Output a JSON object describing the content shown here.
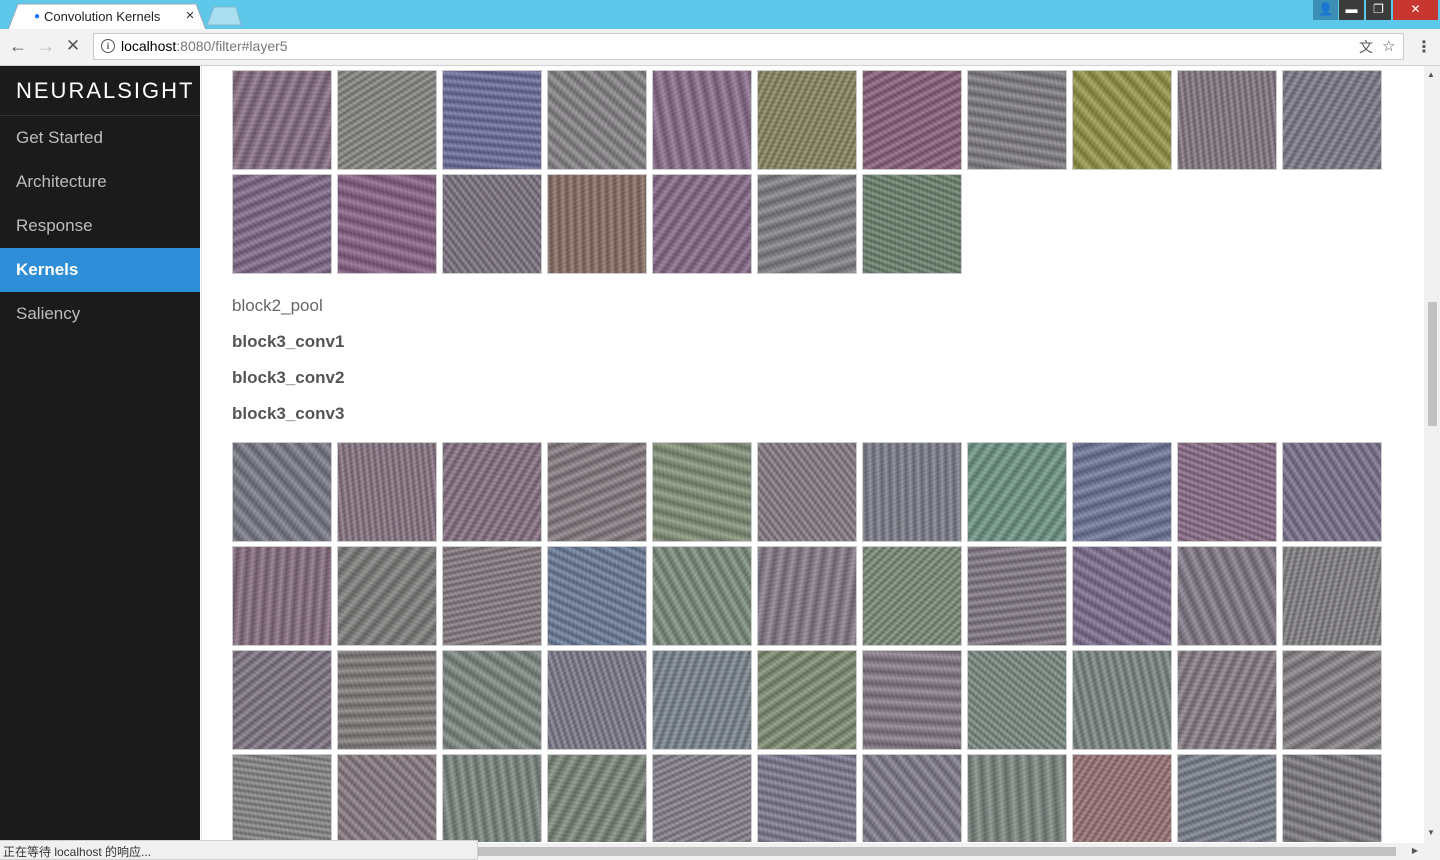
{
  "browser": {
    "tab_title": "Convolution Kernels",
    "tab_close": "×",
    "url_host": "localhost",
    "url_rest": ":8080/filter#layer5",
    "status_text": "正在等待 localhost 的响应...",
    "window_buttons": {
      "minimize": "▬",
      "restore": "❐",
      "close": "✕"
    },
    "icons": {
      "back": "back-arrow-icon",
      "forward": "forward-arrow-icon",
      "stop": "stop-icon",
      "info": "info-icon",
      "translate": "translate-icon",
      "star": "star-icon",
      "menu": "menu-icon"
    }
  },
  "sidebar": {
    "brand": "NEURALSIGHT",
    "items": [
      {
        "label": "Get Started",
        "active": false
      },
      {
        "label": "Architecture",
        "active": false
      },
      {
        "label": "Response",
        "active": false
      },
      {
        "label": "Kernels",
        "active": true
      },
      {
        "label": "Saliency",
        "active": false
      }
    ]
  },
  "main": {
    "layers": [
      {
        "label": "block2_pool"
      },
      {
        "label": "block3_conv1"
      },
      {
        "label": "block3_conv2"
      },
      {
        "label": "block3_conv3"
      }
    ],
    "kernel_group_1": [
      "#8a6f86",
      "#8a8a86",
      "#6f6fa4",
      "#8a878a",
      "#8e6e8f",
      "#8c8a5e",
      "#8e5f7d",
      "#838085",
      "#9a9a46",
      "#877a86",
      "#7f7d8d",
      "#836a8c",
      "#8b6088",
      "#7f7585",
      "#8c6f66",
      "#8a6b8c",
      "#858387",
      "#6e8570"
    ],
    "kernel_group_2": [
      "#7a7c8a",
      "#8b7685",
      "#8a7286",
      "#8a7e85",
      "#86957b",
      "#8b8089",
      "#7f818e",
      "#6f9a88",
      "#6f77a0",
      "#8f6d8d",
      "#7c7292",
      "#8a6f82",
      "#7f7f7d",
      "#8a7e86",
      "#6d7fa0",
      "#7f9180",
      "#887d8c",
      "#7e9078",
      "#847a86",
      "#7f6e92",
      "#857c8a",
      "#878488",
      "#817787",
      "#85807f",
      "#808b84",
      "#817c90",
      "#7d8893",
      "#829075",
      "#8a7c8a",
      "#7d8f86",
      "#7e8b84",
      "#8b7f89",
      "#888388",
      "#8c8b8b",
      "#8b7d85",
      "#7e8a82",
      "#7f8b7d",
      "#8a8490",
      "#7f7d94",
      "#837e8e",
      "#818a84",
      "#a07477",
      "#7d8390",
      "#7f7c82"
    ]
  }
}
